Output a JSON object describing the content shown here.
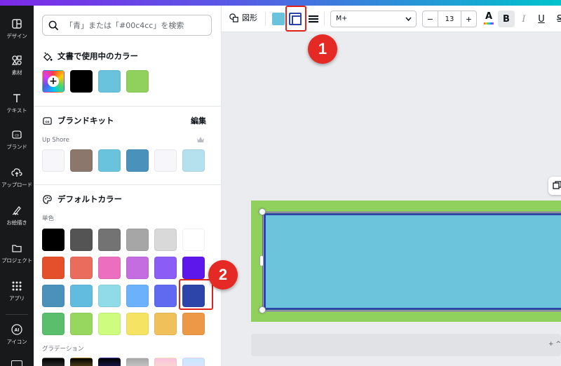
{
  "search": {
    "placeholder": "「青」または「#00c4cc」を検索"
  },
  "rail": {
    "items": [
      {
        "label": "デザイン",
        "icon": "layout-icon"
      },
      {
        "label": "素材",
        "icon": "elements-icon"
      },
      {
        "label": "テキスト",
        "icon": "text-icon"
      },
      {
        "label": "ブランド",
        "icon": "brand-icon"
      },
      {
        "label": "アップロード",
        "icon": "upload-cloud-icon"
      },
      {
        "label": "お絵描き",
        "icon": "draw-icon"
      },
      {
        "label": "プロジェクト",
        "icon": "folder-icon"
      },
      {
        "label": "アプリ",
        "icon": "apps-grid-icon"
      },
      {
        "label": "アイコン",
        "icon": "aicon-icon"
      }
    ]
  },
  "doc_colors": {
    "title": "文書で使用中のカラー",
    "add_glyph": "+",
    "swatches": [
      "#000000",
      "#6ac3dc",
      "#8fd15c"
    ]
  },
  "brand_kit": {
    "title": "ブランドキット",
    "edit_label": "編集",
    "kit_name": "Up Shore",
    "swatches": [
      "#f6f6fb",
      "#8b776b",
      "#6ac3dc",
      "#4a91bb",
      "#f6f6fb",
      "#b5e0ee"
    ]
  },
  "default_colors": {
    "title": "デフォルトカラー",
    "solid_label": "単色",
    "rows": [
      [
        "#000000",
        "#545454",
        "#737373",
        "#a6a6a6",
        "#d9d9d9",
        "#ffffff"
      ],
      [
        "#e4502b",
        "#ea6c5d",
        "#ec6fbf",
        "#c36de0",
        "#8b5cf6",
        "#5d17eb"
      ],
      [
        "#4a91bb",
        "#62bce0",
        "#8fdbe8",
        "#6cb1fb",
        "#5f6af0",
        "#2d45a8"
      ],
      [
        "#5bbe6c",
        "#97d65f",
        "#cefc7e",
        "#f5e363",
        "#f0c15a",
        "#ec9846"
      ]
    ],
    "gradient_label": "グラデーション",
    "gradients": [
      [
        "#000000",
        "#6e6e6e"
      ],
      [
        "#000000",
        "#c19a3d"
      ],
      [
        "#000000",
        "#3d3db8"
      ],
      [
        "#a6a6a6",
        "#f2f2f2"
      ],
      [
        "#f9c3dc",
        "#fff4c4"
      ],
      [
        "#c8e8ff",
        "#f4dbff"
      ]
    ]
  },
  "toolbar": {
    "shape_label": "図形",
    "fill_color": "#6ac3dc",
    "border_color": "#2d45a8",
    "font_name": "M+",
    "minus": "−",
    "font_size": "13",
    "plus": "+",
    "text_color_glyph": "A",
    "bold": "B",
    "italic": "I",
    "underline": "U",
    "strike": "S"
  },
  "canvas": {
    "background": "#ebecf0",
    "outer_color": "#8fd15c",
    "inner_fill": "#6bc3dc",
    "inner_border": "#2d45a8",
    "notes_text": "+ ^"
  },
  "callouts": {
    "one": "1",
    "two": "2"
  }
}
